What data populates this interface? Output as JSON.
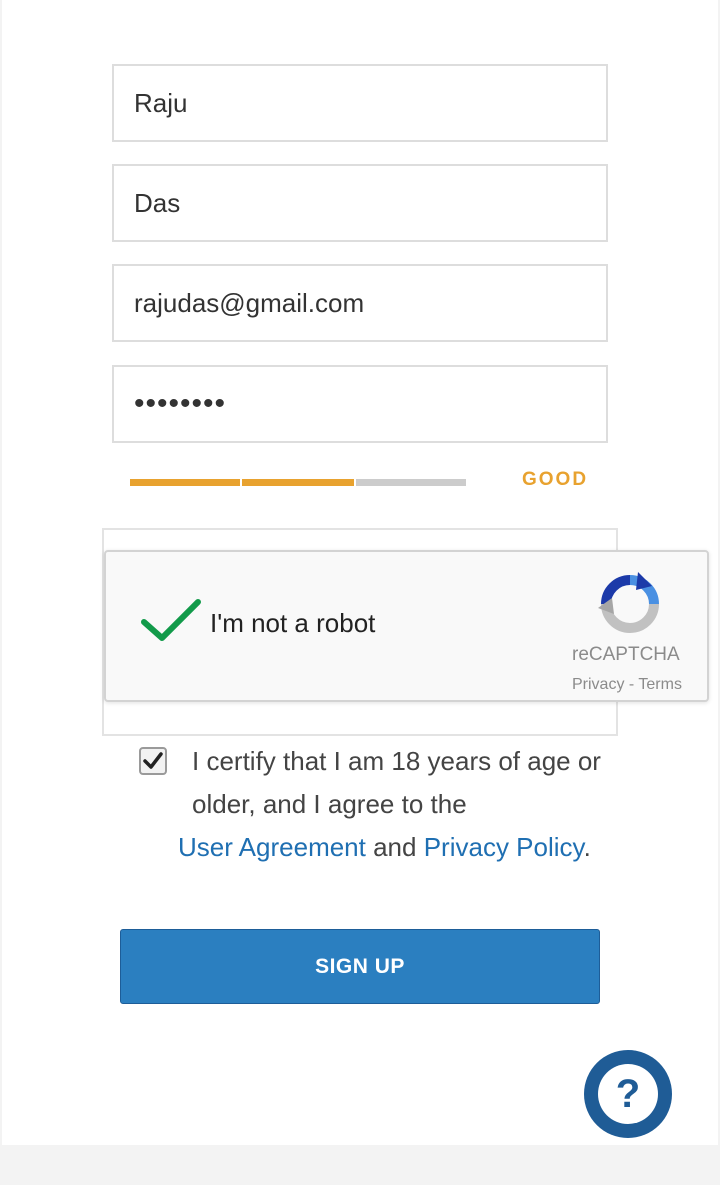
{
  "form": {
    "first_name": "Raju",
    "last_name": "Das",
    "email": "rajudas@gmail.com",
    "password_masked": "••••••••",
    "password_strength": {
      "label": "GOOD",
      "filled_segments": 2,
      "total_segments": 3,
      "color_on": "#e8a22f",
      "color_off": "#cccccc"
    }
  },
  "recaptcha": {
    "label": "I'm not a robot",
    "brand": "reCAPTCHA",
    "privacy": "Privacy",
    "separator": " - ",
    "terms": "Terms",
    "checked": true
  },
  "certify": {
    "checked": true,
    "text_1": "I certify that I am 18 years of age or older, and I agree to the ",
    "link_1": "User Agreement",
    "text_2": " and ",
    "link_2": "Privacy Policy",
    "text_3": "."
  },
  "signup_button": "SIGN UP",
  "help_icon": "?",
  "colors": {
    "accent": "#2b7fc0",
    "link": "#1f6fb2",
    "help_bg": "#1f5c96"
  }
}
